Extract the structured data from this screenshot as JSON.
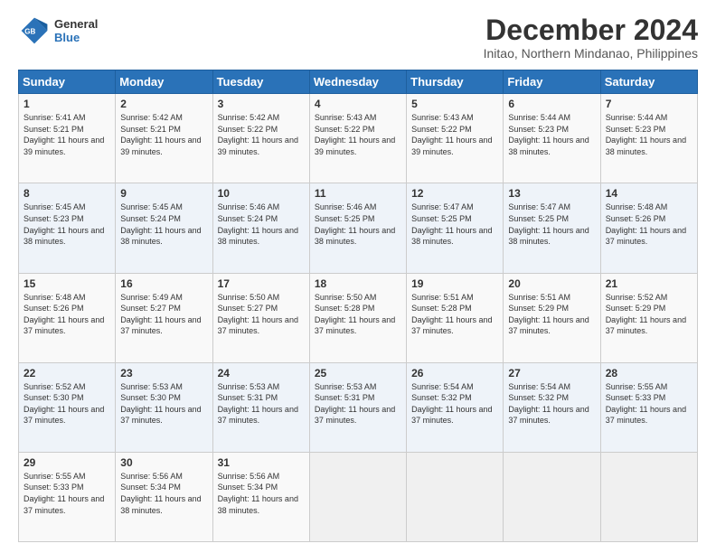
{
  "logo": {
    "line1": "General",
    "line2": "Blue"
  },
  "title": "December 2024",
  "subtitle": "Initao, Northern Mindanao, Philippines",
  "days_of_week": [
    "Sunday",
    "Monday",
    "Tuesday",
    "Wednesday",
    "Thursday",
    "Friday",
    "Saturday"
  ],
  "weeks": [
    [
      {
        "day": "1",
        "sunrise": "5:41 AM",
        "sunset": "5:21 PM",
        "daylight": "11 hours and 39 minutes."
      },
      {
        "day": "2",
        "sunrise": "5:42 AM",
        "sunset": "5:21 PM",
        "daylight": "11 hours and 39 minutes."
      },
      {
        "day": "3",
        "sunrise": "5:42 AM",
        "sunset": "5:22 PM",
        "daylight": "11 hours and 39 minutes."
      },
      {
        "day": "4",
        "sunrise": "5:43 AM",
        "sunset": "5:22 PM",
        "daylight": "11 hours and 39 minutes."
      },
      {
        "day": "5",
        "sunrise": "5:43 AM",
        "sunset": "5:22 PM",
        "daylight": "11 hours and 39 minutes."
      },
      {
        "day": "6",
        "sunrise": "5:44 AM",
        "sunset": "5:23 PM",
        "daylight": "11 hours and 38 minutes."
      },
      {
        "day": "7",
        "sunrise": "5:44 AM",
        "sunset": "5:23 PM",
        "daylight": "11 hours and 38 minutes."
      }
    ],
    [
      {
        "day": "8",
        "sunrise": "5:45 AM",
        "sunset": "5:23 PM",
        "daylight": "11 hours and 38 minutes."
      },
      {
        "day": "9",
        "sunrise": "5:45 AM",
        "sunset": "5:24 PM",
        "daylight": "11 hours and 38 minutes."
      },
      {
        "day": "10",
        "sunrise": "5:46 AM",
        "sunset": "5:24 PM",
        "daylight": "11 hours and 38 minutes."
      },
      {
        "day": "11",
        "sunrise": "5:46 AM",
        "sunset": "5:25 PM",
        "daylight": "11 hours and 38 minutes."
      },
      {
        "day": "12",
        "sunrise": "5:47 AM",
        "sunset": "5:25 PM",
        "daylight": "11 hours and 38 minutes."
      },
      {
        "day": "13",
        "sunrise": "5:47 AM",
        "sunset": "5:25 PM",
        "daylight": "11 hours and 38 minutes."
      },
      {
        "day": "14",
        "sunrise": "5:48 AM",
        "sunset": "5:26 PM",
        "daylight": "11 hours and 37 minutes."
      }
    ],
    [
      {
        "day": "15",
        "sunrise": "5:48 AM",
        "sunset": "5:26 PM",
        "daylight": "11 hours and 37 minutes."
      },
      {
        "day": "16",
        "sunrise": "5:49 AM",
        "sunset": "5:27 PM",
        "daylight": "11 hours and 37 minutes."
      },
      {
        "day": "17",
        "sunrise": "5:50 AM",
        "sunset": "5:27 PM",
        "daylight": "11 hours and 37 minutes."
      },
      {
        "day": "18",
        "sunrise": "5:50 AM",
        "sunset": "5:28 PM",
        "daylight": "11 hours and 37 minutes."
      },
      {
        "day": "19",
        "sunrise": "5:51 AM",
        "sunset": "5:28 PM",
        "daylight": "11 hours and 37 minutes."
      },
      {
        "day": "20",
        "sunrise": "5:51 AM",
        "sunset": "5:29 PM",
        "daylight": "11 hours and 37 minutes."
      },
      {
        "day": "21",
        "sunrise": "5:52 AM",
        "sunset": "5:29 PM",
        "daylight": "11 hours and 37 minutes."
      }
    ],
    [
      {
        "day": "22",
        "sunrise": "5:52 AM",
        "sunset": "5:30 PM",
        "daylight": "11 hours and 37 minutes."
      },
      {
        "day": "23",
        "sunrise": "5:53 AM",
        "sunset": "5:30 PM",
        "daylight": "11 hours and 37 minutes."
      },
      {
        "day": "24",
        "sunrise": "5:53 AM",
        "sunset": "5:31 PM",
        "daylight": "11 hours and 37 minutes."
      },
      {
        "day": "25",
        "sunrise": "5:53 AM",
        "sunset": "5:31 PM",
        "daylight": "11 hours and 37 minutes."
      },
      {
        "day": "26",
        "sunrise": "5:54 AM",
        "sunset": "5:32 PM",
        "daylight": "11 hours and 37 minutes."
      },
      {
        "day": "27",
        "sunrise": "5:54 AM",
        "sunset": "5:32 PM",
        "daylight": "11 hours and 37 minutes."
      },
      {
        "day": "28",
        "sunrise": "5:55 AM",
        "sunset": "5:33 PM",
        "daylight": "11 hours and 37 minutes."
      }
    ],
    [
      {
        "day": "29",
        "sunrise": "5:55 AM",
        "sunset": "5:33 PM",
        "daylight": "11 hours and 37 minutes."
      },
      {
        "day": "30",
        "sunrise": "5:56 AM",
        "sunset": "5:34 PM",
        "daylight": "11 hours and 38 minutes."
      },
      {
        "day": "31",
        "sunrise": "5:56 AM",
        "sunset": "5:34 PM",
        "daylight": "11 hours and 38 minutes."
      },
      null,
      null,
      null,
      null
    ]
  ]
}
